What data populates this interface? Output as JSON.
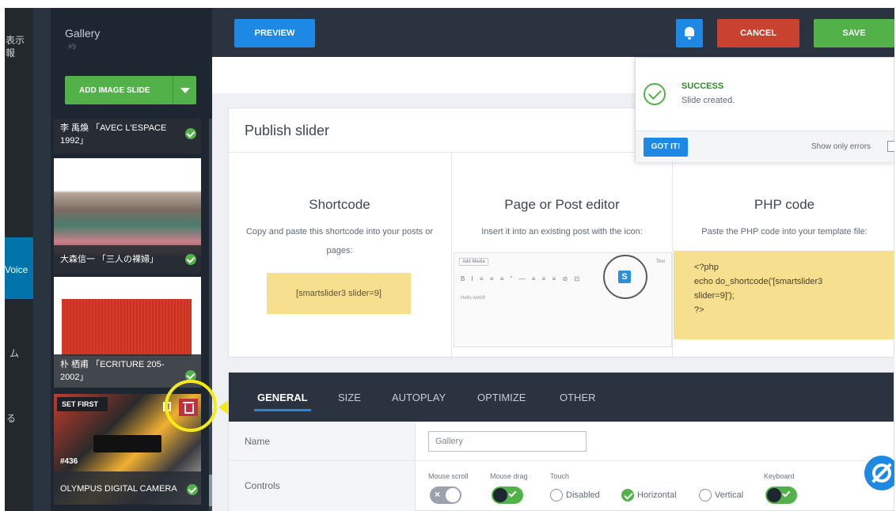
{
  "wp_sidebar": {
    "line1": "表示",
    "line2": "報",
    "active_item": "Voice",
    "line3": "ム",
    "line4": "る"
  },
  "slides_panel": {
    "gallery_title": "Gallery",
    "gallery_id": "#9",
    "add_button": "ADD IMAGE SLIDE",
    "slides": [
      {
        "line1": "李 禹煥 「AVEC L'ESPACE",
        "line2": "1992」"
      },
      {
        "line1": "大森信一 「三人の裸婦」"
      },
      {
        "line1": "朴 栖甫 「ECRITURE 205-",
        "line2": "2002」"
      },
      {
        "line1": "OLYMPUS DIGITAL CAMERA",
        "set_first": "SET FIRST",
        "id": "#436"
      }
    ]
  },
  "topbar": {
    "preview": "PREVIEW",
    "cancel": "CANCEL",
    "save": "SAVE"
  },
  "notice": {
    "title": "SUCCESS",
    "message": "Slide created.",
    "got_it": "GOT IT!",
    "show_errors": "Show only errors"
  },
  "publish": {
    "title": "Publish slider",
    "shortcode": {
      "title": "Shortcode",
      "desc": "Copy and paste this shortcode into your posts or pages:",
      "code": "[smartslider3 slider=9]"
    },
    "editor": {
      "title": "Page or Post editor",
      "desc": "Insert it into an existing post with the icon:",
      "add_media": "Add Media",
      "toolbar": "B I ≡ ≡ ≡ “ — ≡ ≡ ≡ ⊘ ⊡",
      "body": "Hello world!",
      "text_tab": "Text",
      "s_icon": "S"
    },
    "php": {
      "title": "PHP code",
      "desc": "Paste the PHP code into your template file:",
      "line1": "<?php",
      "line2": "echo do_shortcode('[smartslider3",
      "line3": "slider=9]');",
      "line4": "?>"
    }
  },
  "settings": {
    "tabs": [
      "GENERAL",
      "SIZE",
      "AUTOPLAY",
      "OPTIMIZE",
      "OTHER"
    ],
    "name_label": "Name",
    "name_value": "Gallery",
    "controls_label": "Controls",
    "mouse_scroll": "Mouse scroll",
    "mouse_drag": "Mouse drag",
    "touch": "Touch",
    "keyboard": "Keyboard",
    "touch_options": [
      "Disabled",
      "Horizontal",
      "Vertical"
    ],
    "touch_selected": "Horizontal"
  },
  "colors": {
    "accent_blue": "#1e88e5",
    "success_green": "#53b14a",
    "danger_red": "#c9412f",
    "highlight_yellow": "#f4ea18"
  }
}
